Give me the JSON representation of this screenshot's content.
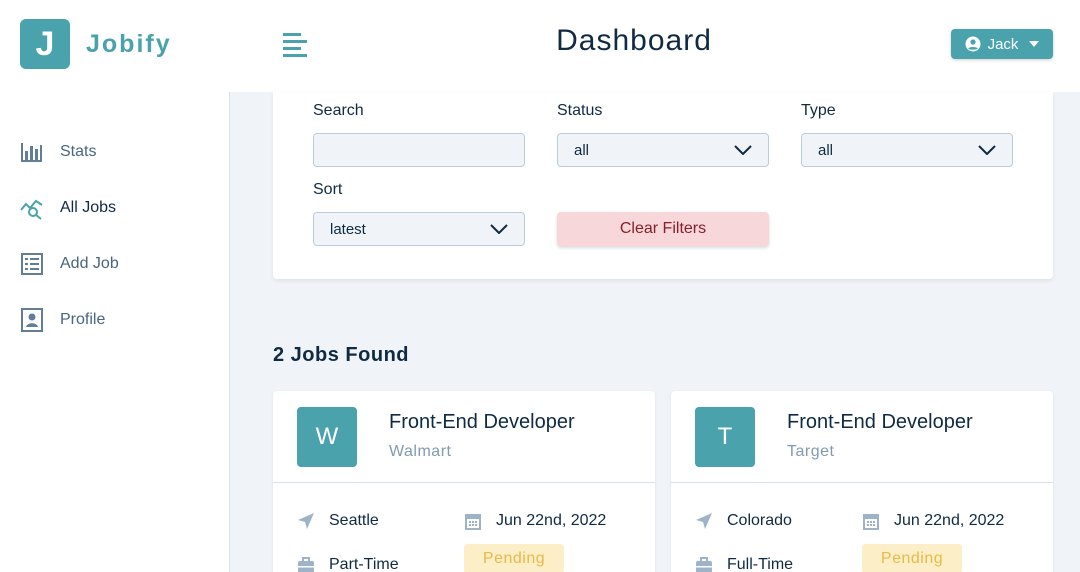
{
  "app": {
    "logo_letter": "J",
    "logo_name": "Jobify",
    "page_title": "Dashboard",
    "user_name": "Jack"
  },
  "colors": {
    "brand": "#4aa3ac",
    "status_pending_bg": "#fcefc7",
    "status_pending_text": "#e9b949",
    "clear_bg": "#f8d7da",
    "clear_text": "#842029"
  },
  "sidebar": {
    "items": [
      {
        "label": "Stats",
        "icon": "bar-chart-icon"
      },
      {
        "label": "All Jobs",
        "icon": "query-stats-icon"
      },
      {
        "label": "Add Job",
        "icon": "form-icon"
      },
      {
        "label": "Profile",
        "icon": "profile-icon"
      }
    ]
  },
  "filters": {
    "search_label": "Search",
    "search_value": "",
    "status_label": "Status",
    "status_value": "all",
    "type_label": "Type",
    "type_value": "all",
    "sort_label": "Sort",
    "sort_value": "latest",
    "clear_label": "Clear Filters"
  },
  "results": {
    "count_text": "2 Jobs Found"
  },
  "jobs": [
    {
      "avatar": "W",
      "position": "Front-End Developer",
      "company": "Walmart",
      "location": "Seattle",
      "date": "Jun 22nd, 2022",
      "type": "Part-Time",
      "status": "Pending"
    },
    {
      "avatar": "T",
      "position": "Front-End Developer",
      "company": "Target",
      "location": "Colorado",
      "date": "Jun 22nd, 2022",
      "type": "Full-Time",
      "status": "Pending"
    }
  ]
}
